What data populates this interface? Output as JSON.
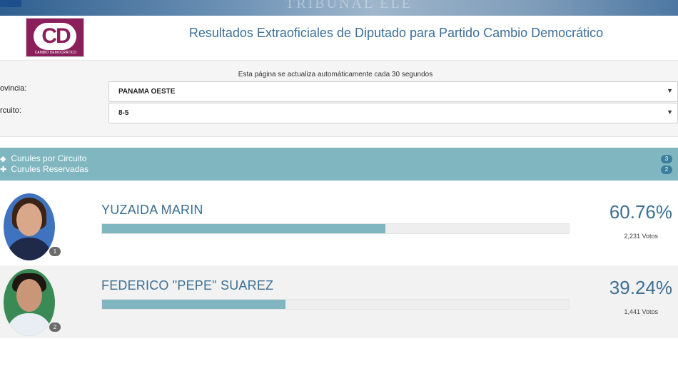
{
  "banner": {
    "text": "TRIBUNAL ELE"
  },
  "header": {
    "logo": {
      "letters": "CD",
      "caption": "CAMBIO DEMOCRÁTICO"
    },
    "title": "Resultados Extraoficiales de Diputado para Partido Cambio Democrático"
  },
  "filters": {
    "auto_update_note": "Esta página se actualiza automáticamente cada 30 segundos",
    "provincia_label": "ovincia:",
    "provincia_value": "PANAMA OESTE",
    "circuito_label": "rcuito:",
    "circuito_value": "8-5",
    "dropdown_arrow": "▼"
  },
  "curules": {
    "por_circuito_label": "Curules por Circuito",
    "por_circuito_count": "3",
    "reservadas_label": "Curules Reservadas",
    "reservadas_count": "2"
  },
  "candidates": [
    {
      "rank": "1",
      "name": "YUZAIDA MARIN",
      "percent_text": "60.76%",
      "percent": 60.76,
      "votes": "2,231 Votos"
    },
    {
      "rank": "2",
      "name": "FEDERICO \"PEPE\" SUAREZ",
      "percent_text": "39.24%",
      "percent": 39.24,
      "votes": "1,441 Votos"
    }
  ],
  "colors": {
    "accent": "#7fb6c0",
    "brand": "#8a1f5c",
    "title_blue": "#3a6f9a"
  }
}
